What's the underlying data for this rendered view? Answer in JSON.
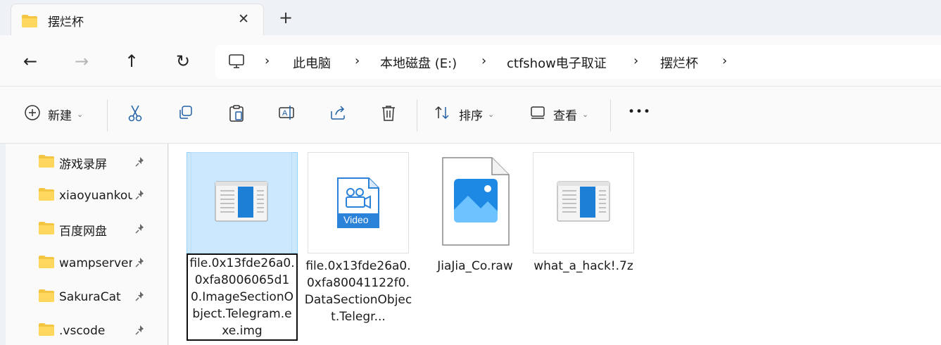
{
  "tab": {
    "title": "摆烂杯",
    "close_label": "✕",
    "new_tab_label": "+"
  },
  "nav": {
    "back": "←",
    "forward": "→",
    "up": "↑",
    "refresh": "↻"
  },
  "breadcrumb": [
    "此电脑",
    "本地磁盘 (E:)",
    "ctfshow电子取证",
    "摆烂杯"
  ],
  "toolbar": {
    "new_label": "新建",
    "sort_label": "排序",
    "view_label": "查看",
    "more_label": "•••"
  },
  "sidebar": {
    "items": [
      {
        "label": "游戏录屏"
      },
      {
        "label": "xiaoyuankou"
      },
      {
        "label": "百度网盘"
      },
      {
        "label": "wampserver"
      },
      {
        "label": "SakuraCat"
      },
      {
        "label": ".vscode"
      }
    ]
  },
  "files": [
    {
      "name": "file.0x13fde26a0.0xfa8006065d10.ImageSectionObject.Telegram.exe.img",
      "icon": "executable-window-icon",
      "selected": true
    },
    {
      "name": "file.0x13fde26a0.0xfa80041122f0.DataSectionObject.Telegr...",
      "icon": "video-file-icon",
      "video_label": "Video"
    },
    {
      "name": "JiaJia_Co.raw",
      "icon": "image-file-icon"
    },
    {
      "name": "what_a_hack!.7z",
      "icon": "executable-window-icon"
    }
  ],
  "colors": {
    "accent": "#0078d4",
    "folder": "#f4c443",
    "selection": "#cce8ff"
  }
}
